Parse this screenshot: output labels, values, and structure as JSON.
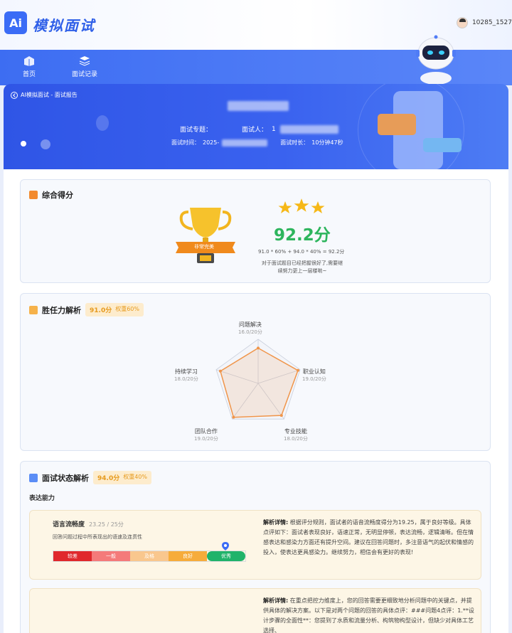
{
  "header": {
    "logo_badge": "Ai",
    "app_title": "模拟面试",
    "user_id": "10285_1527"
  },
  "nav": [
    {
      "label": "首页",
      "icon": "home-icon"
    },
    {
      "label": "面试记录",
      "icon": "records-icon"
    }
  ],
  "banner": {
    "breadcrumb": "AI模拟面试 - 面试报告",
    "topic_label": "面试专题：",
    "interviewer_label": "面试人：",
    "interviewer_value_prefix": "1",
    "time_label": "面试时间：",
    "time_value": "2025-",
    "duration_label": "面试时长：",
    "duration_value": "10分钟47秒"
  },
  "overall": {
    "title": "综合得分",
    "trophy_label": "非常完美",
    "stars": 3,
    "score": "92.2分",
    "formula": "91.0 * 60% + 94.0 * 40% = 92.2分",
    "comment": "对于面试题目已经把握很好了,需要继续努力更上一层楼喲~"
  },
  "competency": {
    "title": "胜任力解析",
    "score": "91.0分",
    "weight": "权重60%",
    "dimensions": [
      {
        "label": "问题解决",
        "value": "16.0/20分",
        "score": 16.0
      },
      {
        "label": "职业认知",
        "value": "19.0/20分",
        "score": 19.0
      },
      {
        "label": "专业技能",
        "value": "18.0/20分",
        "score": 18.0
      },
      {
        "label": "团队合作",
        "value": "19.0/20分",
        "score": 19.0
      },
      {
        "label": "持续学习",
        "value": "18.0/20分",
        "score": 18.0
      }
    ],
    "max": 20
  },
  "status": {
    "title": "面试状态解析",
    "score": "94.0分",
    "weight": "权重40%",
    "subhead": "表达能力",
    "metric1": {
      "name": "语言流畅度",
      "score": "23.25 / 25分",
      "desc": "回答问题过程中所表现出的语速及连贯性",
      "scale": [
        "较差",
        "一般",
        "及格",
        "良好",
        "优秀"
      ],
      "detail_label": "解析详情:",
      "detail": "根据评分规则，面试者的语音流畅度得分为19.25，属于良好等级。具体点评如下：面试者表现良好，语速正常，无明显停顿，表达流畅，逻辑清晰。但在情感表达和感染力方面还有提升空间。建议在回答问题时，多注意语气的起伏和情感的投入，使表达更具感染力。继续努力，相信会有更好的表现!"
    },
    "metric2": {
      "detail_label": "解析详情:",
      "detail": "在重点把控力维度上，您的回答需要更细致地分析问题中的关键点，并提供具体的解决方案。以下是对两个问题的回答的具体点评：###问题4点评：1.**设计步骤的全面性**：您提到了水质和流量分析、构筑物构型设计，但缺少对具体工艺选择、"
    }
  },
  "colors": {
    "primary": "#3b6cf6",
    "score_green": "#2db55d",
    "badge_orange": "#e69a1e",
    "radar_line": "#f0954a"
  }
}
